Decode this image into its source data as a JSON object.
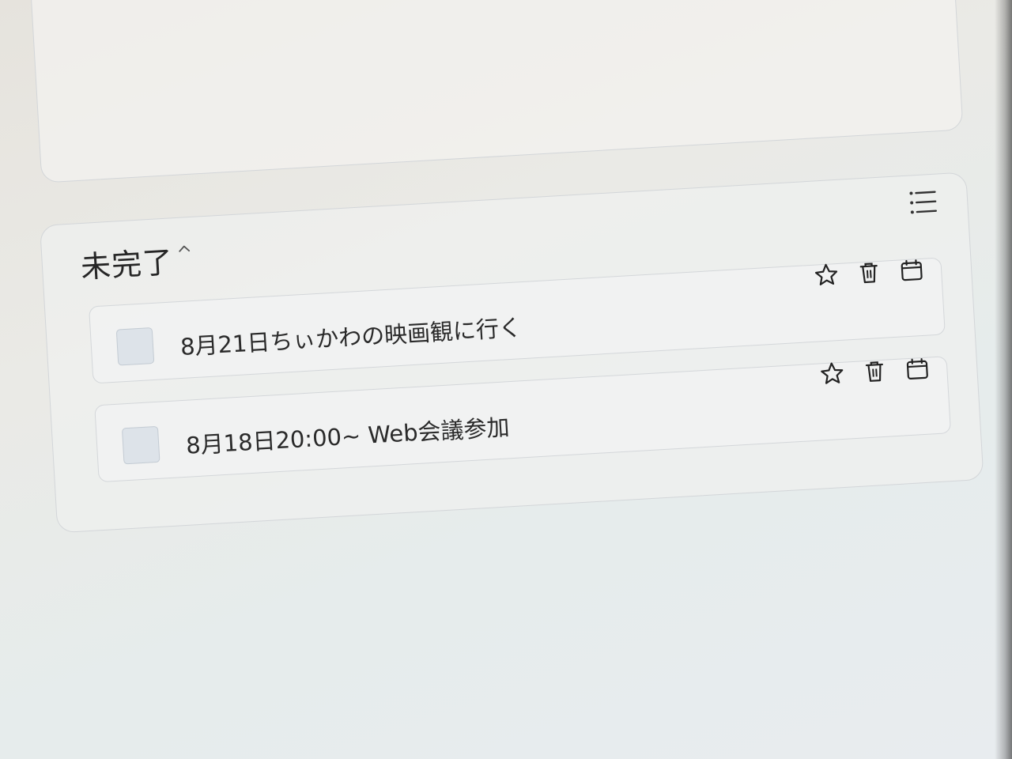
{
  "section": {
    "title": "未完了",
    "collapse_icon": "chevron-up-icon",
    "sort_icon": "list-icon"
  },
  "tasks": [
    {
      "text": "8月21日ちぃかわの映画観に行く",
      "completed": false,
      "actions": [
        "star-icon",
        "trash-icon",
        "calendar-icon"
      ]
    },
    {
      "text": "8月18日20:00~ Web会議参加",
      "completed": false,
      "actions": [
        "star-icon",
        "trash-icon",
        "calendar-icon"
      ]
    }
  ]
}
